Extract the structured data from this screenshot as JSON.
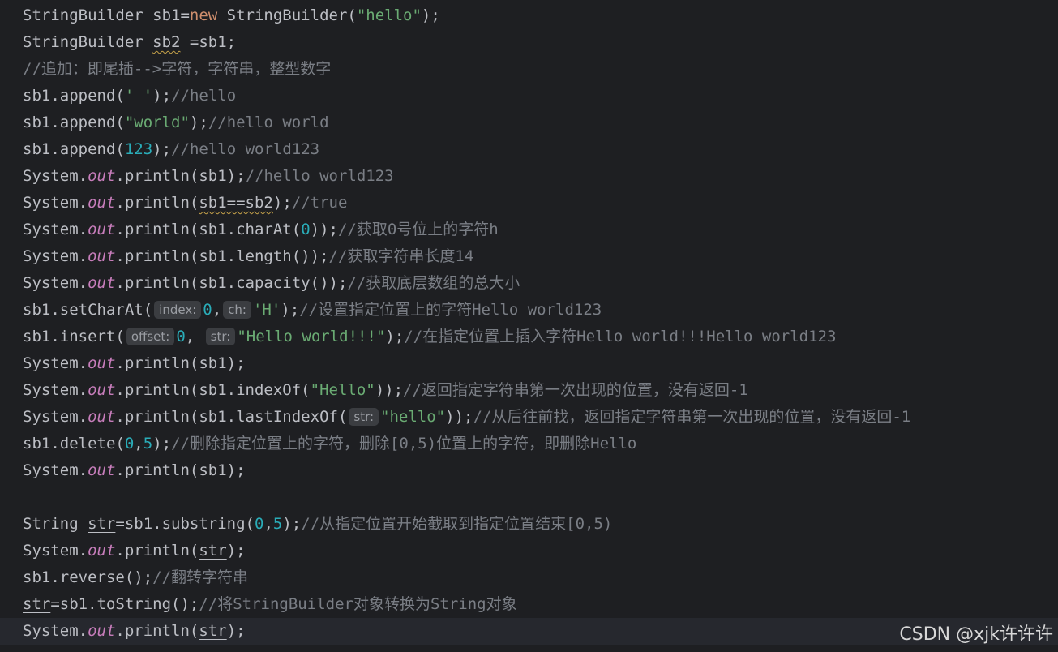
{
  "lines": [
    {
      "current": false,
      "tokens": [
        {
          "t": "StringBuilder sb1=",
          "c": "plain"
        },
        {
          "t": "new",
          "c": "kw"
        },
        {
          "t": " StringBuilder(",
          "c": "plain"
        },
        {
          "t": "\"hello\"",
          "c": "str"
        },
        {
          "t": ");",
          "c": "plain"
        }
      ]
    },
    {
      "current": false,
      "tokens": [
        {
          "t": "StringBuilder ",
          "c": "plain"
        },
        {
          "t": "sb2",
          "c": "warn"
        },
        {
          "t": " =sb1;",
          "c": "plain"
        }
      ]
    },
    {
      "current": false,
      "tokens": [
        {
          "t": "//追加：即尾插-->字符，字符串，整型数字",
          "c": "cmt"
        }
      ]
    },
    {
      "current": false,
      "tokens": [
        {
          "t": "sb1.append(",
          "c": "plain"
        },
        {
          "t": "' '",
          "c": "str"
        },
        {
          "t": ");",
          "c": "plain"
        },
        {
          "t": "//hello",
          "c": "cmt"
        }
      ]
    },
    {
      "current": false,
      "tokens": [
        {
          "t": "sb1.append(",
          "c": "plain"
        },
        {
          "t": "\"world\"",
          "c": "str"
        },
        {
          "t": ");",
          "c": "plain"
        },
        {
          "t": "//hello world",
          "c": "cmt"
        }
      ]
    },
    {
      "current": false,
      "tokens": [
        {
          "t": "sb1.append(",
          "c": "plain"
        },
        {
          "t": "123",
          "c": "num"
        },
        {
          "t": ");",
          "c": "plain"
        },
        {
          "t": "//hello world123",
          "c": "cmt"
        }
      ]
    },
    {
      "current": false,
      "tokens": [
        {
          "t": "System.",
          "c": "plain"
        },
        {
          "t": "out",
          "c": "fld"
        },
        {
          "t": ".println(sb1);",
          "c": "plain"
        },
        {
          "t": "//hello world123",
          "c": "cmt"
        }
      ]
    },
    {
      "current": false,
      "tokens": [
        {
          "t": "System.",
          "c": "plain"
        },
        {
          "t": "out",
          "c": "fld"
        },
        {
          "t": ".println(",
          "c": "plain"
        },
        {
          "t": "sb1==sb2",
          "c": "warn"
        },
        {
          "t": ");",
          "c": "plain"
        },
        {
          "t": "//true",
          "c": "cmt"
        }
      ]
    },
    {
      "current": false,
      "tokens": [
        {
          "t": "System.",
          "c": "plain"
        },
        {
          "t": "out",
          "c": "fld"
        },
        {
          "t": ".println(sb1.charAt(",
          "c": "plain"
        },
        {
          "t": "0",
          "c": "num"
        },
        {
          "t": "));",
          "c": "plain"
        },
        {
          "t": "//获取0号位上的字符h",
          "c": "cmt"
        }
      ]
    },
    {
      "current": false,
      "tokens": [
        {
          "t": "System.",
          "c": "plain"
        },
        {
          "t": "out",
          "c": "fld"
        },
        {
          "t": ".println(sb1.length());",
          "c": "plain"
        },
        {
          "t": "//获取字符串长度14",
          "c": "cmt"
        }
      ]
    },
    {
      "current": false,
      "tokens": [
        {
          "t": "System.",
          "c": "plain"
        },
        {
          "t": "out",
          "c": "fld"
        },
        {
          "t": ".println(sb1.capacity());",
          "c": "plain"
        },
        {
          "t": "//获取底层数组的总大小",
          "c": "cmt"
        }
      ]
    },
    {
      "current": false,
      "tokens": [
        {
          "t": "sb1.setCharAt(",
          "c": "plain"
        },
        {
          "t": "index:",
          "c": "hint"
        },
        {
          "t": "0",
          "c": "num"
        },
        {
          "t": ",",
          "c": "plain"
        },
        {
          "t": "ch:",
          "c": "hint"
        },
        {
          "t": "'H'",
          "c": "str"
        },
        {
          "t": ");",
          "c": "plain"
        },
        {
          "t": "//设置指定位置上的字符Hello world123",
          "c": "cmt"
        }
      ]
    },
    {
      "current": false,
      "tokens": [
        {
          "t": "sb1.insert(",
          "c": "plain"
        },
        {
          "t": "offset:",
          "c": "hint"
        },
        {
          "t": "0",
          "c": "num"
        },
        {
          "t": ", ",
          "c": "plain"
        },
        {
          "t": "str:",
          "c": "hint"
        },
        {
          "t": "\"Hello world!!!\"",
          "c": "str"
        },
        {
          "t": ");",
          "c": "plain"
        },
        {
          "t": "//在指定位置上插入字符Hello world!!!Hello world123",
          "c": "cmt"
        }
      ]
    },
    {
      "current": false,
      "tokens": [
        {
          "t": "System.",
          "c": "plain"
        },
        {
          "t": "out",
          "c": "fld"
        },
        {
          "t": ".println(sb1);",
          "c": "plain"
        }
      ]
    },
    {
      "current": false,
      "tokens": [
        {
          "t": "System.",
          "c": "plain"
        },
        {
          "t": "out",
          "c": "fld"
        },
        {
          "t": ".println(sb1.indexOf(",
          "c": "plain"
        },
        {
          "t": "\"Hello\"",
          "c": "str"
        },
        {
          "t": "));",
          "c": "plain"
        },
        {
          "t": "//返回指定字符串第一次出现的位置，没有返回-1",
          "c": "cmt"
        }
      ]
    },
    {
      "current": false,
      "tokens": [
        {
          "t": "System.",
          "c": "plain"
        },
        {
          "t": "out",
          "c": "fld"
        },
        {
          "t": ".println(sb1.lastIndexOf(",
          "c": "plain"
        },
        {
          "t": "str:",
          "c": "hint"
        },
        {
          "t": "\"hello\"",
          "c": "str"
        },
        {
          "t": "));",
          "c": "plain"
        },
        {
          "t": "//从后往前找，返回指定字符串第一次出现的位置，没有返回-1",
          "c": "cmt"
        }
      ]
    },
    {
      "current": false,
      "tokens": [
        {
          "t": "sb1.delete(",
          "c": "plain"
        },
        {
          "t": "0",
          "c": "num"
        },
        {
          "t": ",",
          "c": "plain"
        },
        {
          "t": "5",
          "c": "num"
        },
        {
          "t": ");",
          "c": "plain"
        },
        {
          "t": "//删除指定位置上的字符，删除[0,5)位置上的字符，即删除Hello",
          "c": "cmt"
        }
      ]
    },
    {
      "current": false,
      "tokens": [
        {
          "t": "System.",
          "c": "plain"
        },
        {
          "t": "out",
          "c": "fld"
        },
        {
          "t": ".println(sb1);",
          "c": "plain"
        }
      ]
    },
    {
      "current": false,
      "tokens": []
    },
    {
      "current": false,
      "tokens": [
        {
          "t": "String ",
          "c": "plain"
        },
        {
          "t": "str",
          "c": "uline"
        },
        {
          "t": "=sb1.substring(",
          "c": "plain"
        },
        {
          "t": "0",
          "c": "num"
        },
        {
          "t": ",",
          "c": "plain"
        },
        {
          "t": "5",
          "c": "num"
        },
        {
          "t": ");",
          "c": "plain"
        },
        {
          "t": "//从指定位置开始截取到指定位置结束[0,5)",
          "c": "cmt"
        }
      ]
    },
    {
      "current": false,
      "tokens": [
        {
          "t": "System.",
          "c": "plain"
        },
        {
          "t": "out",
          "c": "fld"
        },
        {
          "t": ".println(",
          "c": "plain"
        },
        {
          "t": "str",
          "c": "uline"
        },
        {
          "t": ");",
          "c": "plain"
        }
      ]
    },
    {
      "current": false,
      "tokens": [
        {
          "t": "sb1.reverse();",
          "c": "plain"
        },
        {
          "t": "//翻转字符串",
          "c": "cmt"
        }
      ]
    },
    {
      "current": false,
      "tokens": [
        {
          "t": "str",
          "c": "uline"
        },
        {
          "t": "=sb1.toString();",
          "c": "plain"
        },
        {
          "t": "//将StringBuilder对象转换为String对象",
          "c": "cmt"
        }
      ]
    },
    {
      "current": true,
      "tokens": [
        {
          "t": "System.",
          "c": "plain"
        },
        {
          "t": "out",
          "c": "fld"
        },
        {
          "t": ".println(",
          "c": "plain"
        },
        {
          "t": "str",
          "c": "uline"
        },
        {
          "t": ");",
          "c": "plain"
        }
      ]
    }
  ],
  "watermark": "CSDN @xjk许许许",
  "colors": {
    "background": "#1e1f22",
    "current_line": "#26282e",
    "text": "#bcbec4",
    "keyword": "#cf8e6d",
    "string": "#6aab73",
    "number": "#2aacb8",
    "field": "#c77dbb",
    "comment": "#7a7e85",
    "hint_bg": "#3b3d41"
  }
}
